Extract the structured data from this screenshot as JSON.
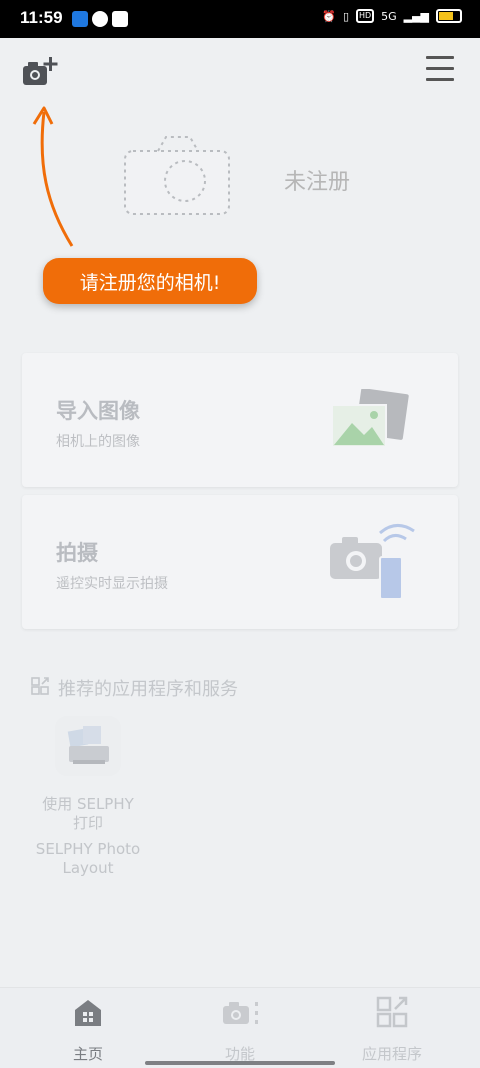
{
  "status_bar": {
    "time": "11:59",
    "network": "5G",
    "battery_level": "2",
    "hd_label": "HD"
  },
  "header": {
    "add_camera_icon": "camera-add-icon",
    "menu_icon": "hamburger-menu-icon"
  },
  "camera_status": {
    "label": "未注册"
  },
  "tooltip": {
    "text": "请注册您的相机!"
  },
  "cards": [
    {
      "title": "导入图像",
      "subtitle": "相机上的图像",
      "icon": "photos-icon"
    },
    {
      "title": "拍摄",
      "subtitle": "遥控实时显示拍摄",
      "icon": "remote-camera-icon"
    }
  ],
  "recommended": {
    "section_title": "推荐的应用程序和服务",
    "apps": [
      {
        "name_line1": "使用 SELPHY",
        "name_line2": "打印",
        "sub_line1": "SELPHY Photo",
        "sub_line2": "Layout"
      }
    ]
  },
  "bottom_nav": {
    "items": [
      {
        "label": "主页",
        "icon": "home-icon",
        "active": true
      },
      {
        "label": "功能",
        "icon": "camera-functions-icon",
        "active": false
      },
      {
        "label": "应用程序",
        "icon": "apps-grid-icon",
        "active": false
      }
    ]
  },
  "colors": {
    "accent": "#f06d09",
    "background": "#eef0f2",
    "active_nav": "#7a7d82",
    "inactive": "#c4c7cb"
  }
}
